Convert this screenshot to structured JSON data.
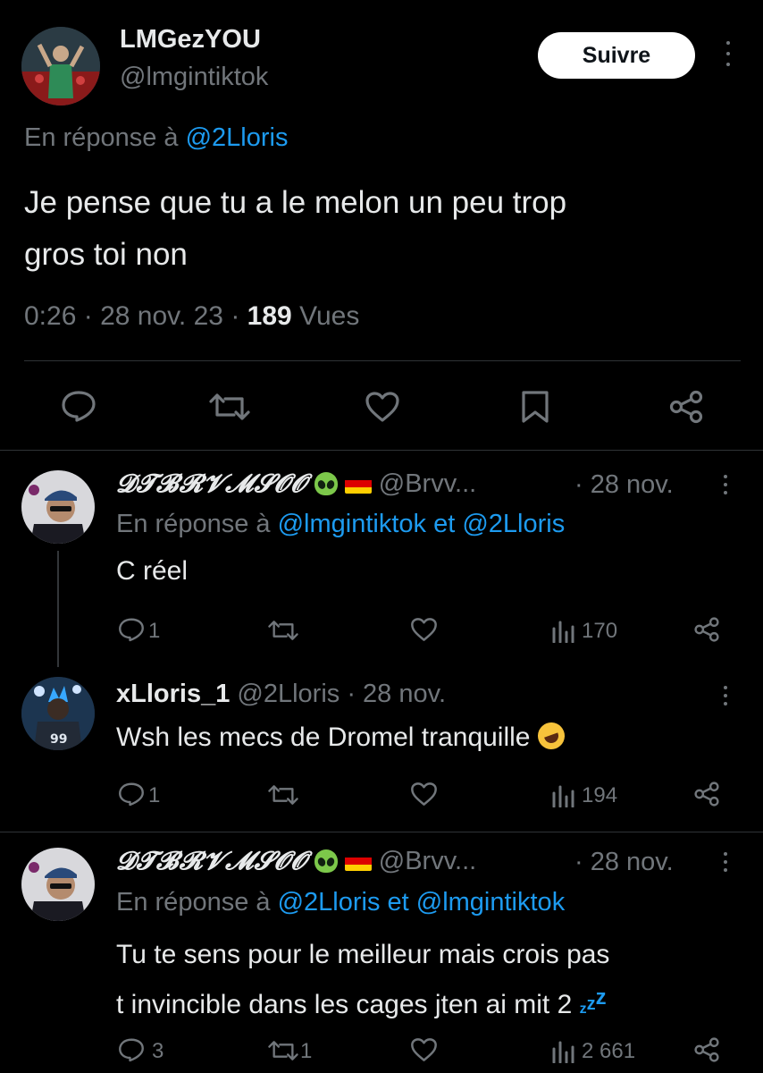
{
  "main_tweet": {
    "display_name": "LMGezYOU",
    "handle": "@lmgintiktok",
    "follow_label": "Suivre",
    "reply_prefix": "En réponse à",
    "reply_to": "@2Lloris",
    "text_line1": "Je pense que tu a le melon un peu trop",
    "text_line2": "gros toi non",
    "time": "0:26",
    "date": "28 nov. 23",
    "separator": "·",
    "views_count": "189",
    "views_label": "Vues",
    "actions": [
      "reply-icon",
      "retweet-icon",
      "like-icon",
      "bookmark-icon",
      "share-icon"
    ]
  },
  "replies": [
    {
      "display_name": "𝓓𝓣𝓑𝓡𝓥𝓜𝓢𝓞𝓞",
      "handle": "@Brvv...",
      "date": "· 28 nov.",
      "reply_prefix": "En réponse à",
      "mention1": "@lmgintiktok",
      "conjunction": "et",
      "mention2": "@2Lloris",
      "text": "C réel",
      "replies": "1",
      "retweets": "",
      "views": "170"
    },
    {
      "display_name": "xLloris_1",
      "handle": "@2Lloris",
      "date": "· 28 nov.",
      "text": "Wsh les mecs de Dromel tranquille",
      "replies": "1",
      "retweets": "",
      "views": "194"
    },
    {
      "display_name": "𝓓𝓣𝓑𝓡𝓥𝓜𝓢𝓞𝓞",
      "handle": "@Brvv...",
      "date": "· 28 nov.",
      "reply_prefix": "En réponse à",
      "mention1": "@2Lloris",
      "conjunction": "et",
      "mention2": "@lmgintiktok",
      "text_line1": "Tu te sens pour le meilleur mais crois pas",
      "text_line2": "t invincible dans les cages jten ai mit 2",
      "replies": "3",
      "retweets": "1",
      "views": "2 661"
    }
  ],
  "colors": {
    "background": "#000000",
    "text": "#e7e9ea",
    "secondary": "#71767b",
    "link": "#1d9bf0",
    "divider": "#2f3336"
  }
}
